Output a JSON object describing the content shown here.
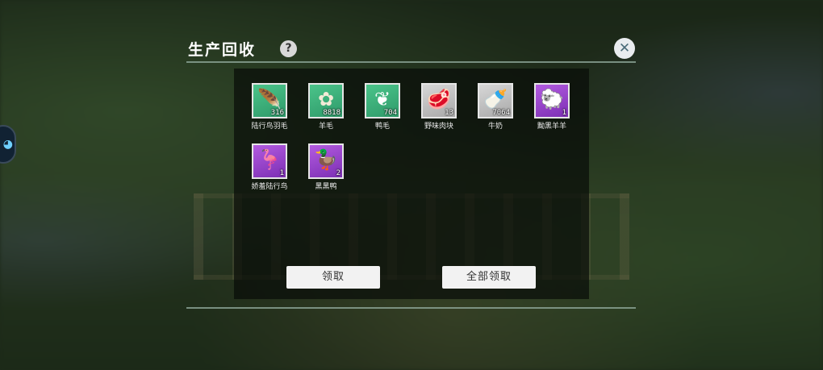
{
  "dialog": {
    "title": "生产回收",
    "help_glyph": "?",
    "close_glyph": "✕"
  },
  "items": [
    {
      "name": "陆行鸟羽毛",
      "qty": "316",
      "bg": "green",
      "icon": "feather-icon",
      "glyph": "🪶"
    },
    {
      "name": "羊毛",
      "qty": "8818",
      "bg": "green",
      "icon": "wool-icon",
      "glyph": "✿"
    },
    {
      "name": "鸭毛",
      "qty": "704",
      "bg": "green",
      "icon": "duck-feather-icon",
      "glyph": "❦"
    },
    {
      "name": "野味肉块",
      "qty": "13",
      "bg": "gray",
      "icon": "meat-icon",
      "glyph": "🥩"
    },
    {
      "name": "牛奶",
      "qty": "7064",
      "bg": "gray",
      "icon": "milk-bottle-icon",
      "glyph": "🍼"
    },
    {
      "name": "黝黑羊羊",
      "qty": "1",
      "bg": "purple",
      "icon": "black-sheep-icon",
      "glyph": "🐑"
    },
    {
      "name": "娇羞陆行鸟",
      "qty": "1",
      "bg": "purple",
      "icon": "pink-chocobo-icon",
      "glyph": "🦩"
    },
    {
      "name": "黑黑鸭",
      "qty": "2",
      "bg": "purple",
      "icon": "black-duck-icon",
      "glyph": "🦆"
    }
  ],
  "buttons": {
    "claim": "领取",
    "claim_all": "全部领取"
  }
}
